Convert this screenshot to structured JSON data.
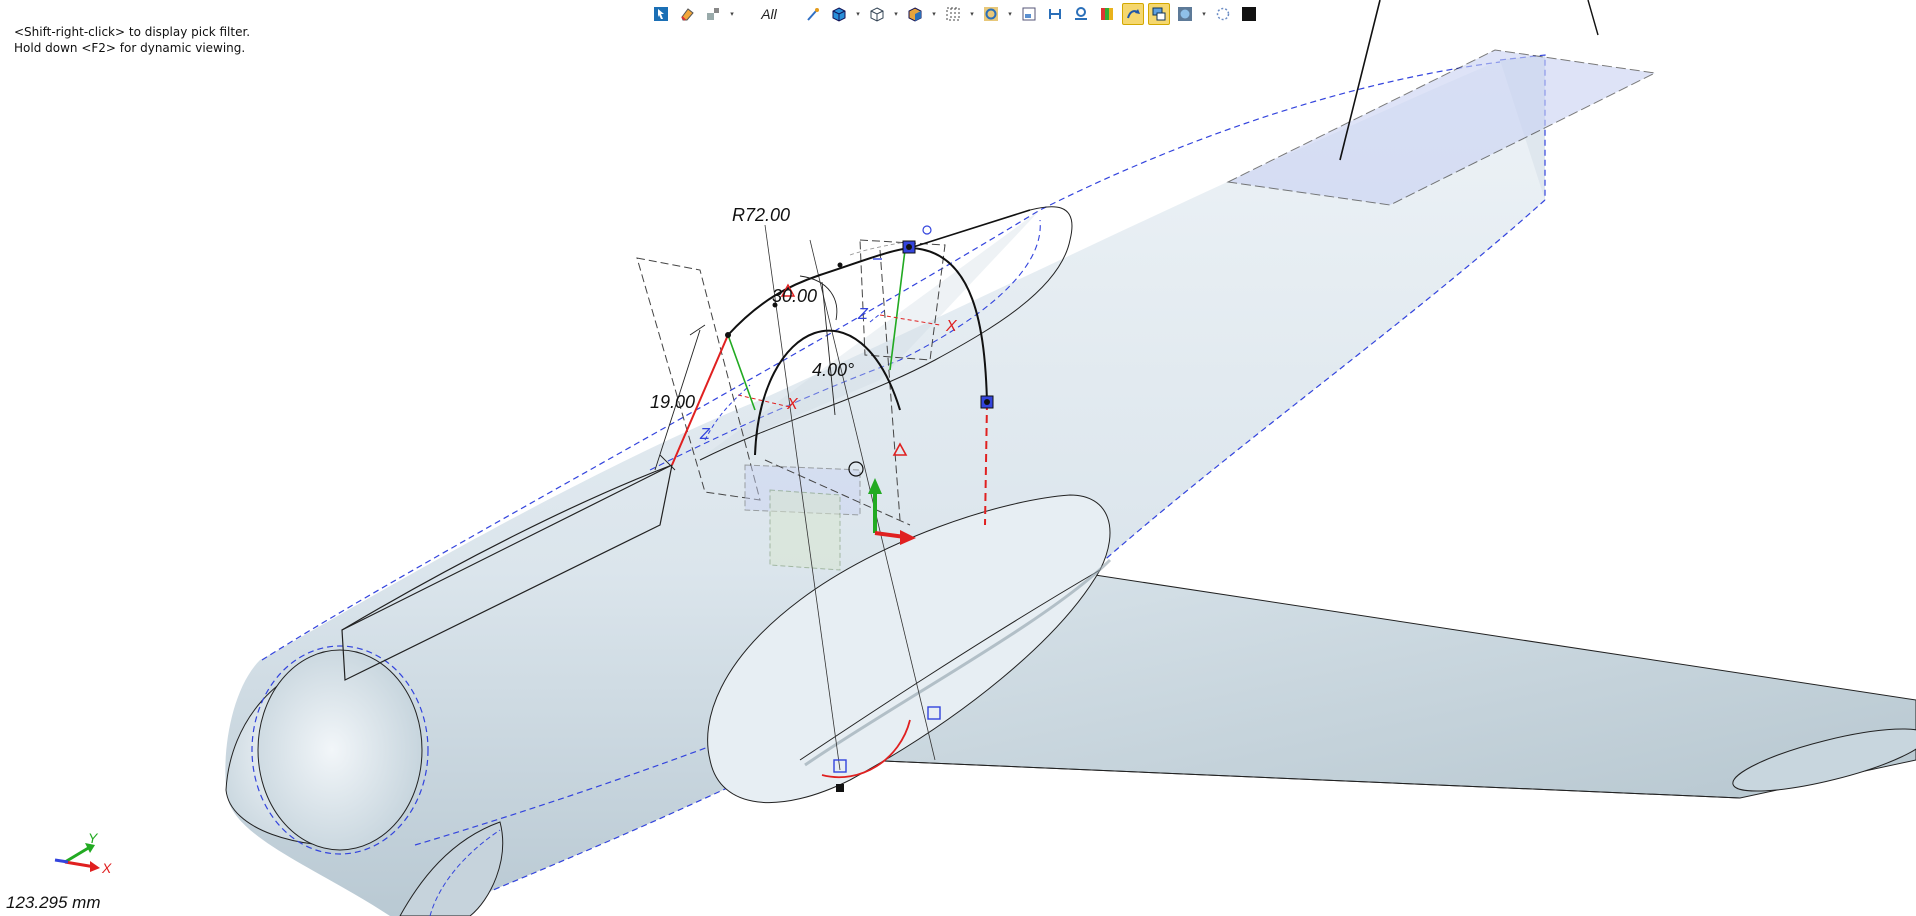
{
  "hints": {
    "line1": "<Shift-right-click> to display pick filter.",
    "line2": "Hold down <F2> for dynamic viewing."
  },
  "toolbar": {
    "filter_label": "All",
    "buttons": [
      {
        "name": "select-icon"
      },
      {
        "name": "eraser-icon"
      },
      {
        "name": "snap-icon"
      },
      {
        "name": "magic-wand-icon"
      },
      {
        "name": "solid-cube-icon"
      },
      {
        "name": "wire-cube-icon"
      },
      {
        "name": "shaded-cube-icon"
      },
      {
        "name": "grid-icon"
      },
      {
        "name": "ring-icon"
      },
      {
        "name": "view-plane-icon"
      },
      {
        "name": "horizontal-icon"
      },
      {
        "name": "tangent-icon"
      },
      {
        "name": "color-bars-icon"
      },
      {
        "name": "curve-arrow-icon",
        "active": true
      },
      {
        "name": "layers-icon",
        "active": true
      },
      {
        "name": "globe-icon"
      },
      {
        "name": "dotted-circle-icon"
      },
      {
        "name": "black-square-icon"
      }
    ]
  },
  "dimensions": {
    "radius": "R72.00",
    "length": "30.00",
    "angle": "4.00°",
    "height": "19.00"
  },
  "triad": {
    "x": "X",
    "y": "Y",
    "z": "Z"
  },
  "scale_readout": "123.295 mm",
  "colors": {
    "edge_dashed": "#3344dd",
    "fuselage_fill": "#dfe8ee",
    "wing_fill": "#cfdce4",
    "constraint_red": "#e02020",
    "axis_green": "#22aa22",
    "toolbar_active": "#f5d76e"
  }
}
